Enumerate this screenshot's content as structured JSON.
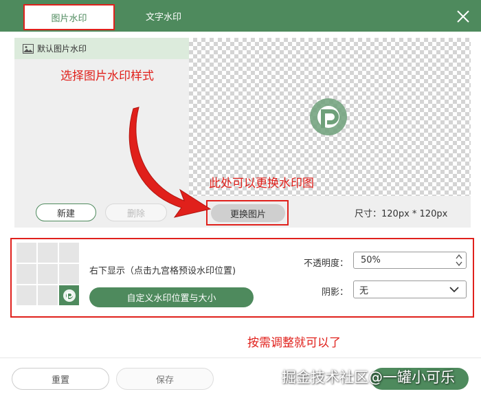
{
  "tabs": {
    "image_watermark": "图片水印",
    "text_watermark": "文字水印"
  },
  "watermark_list": {
    "default_item": "默认图片水印"
  },
  "actions": {
    "new": "新建",
    "delete": "删除",
    "change_image": "更换图片"
  },
  "preview": {
    "size_label": "尺寸：120px * 120px"
  },
  "annotations": {
    "select_style": "选择图片水印样式",
    "change_here": "此处可以更换水印图",
    "adjust": "按需调整就可以了"
  },
  "position": {
    "label": "右下显示（点击九宫格预设水印位置)",
    "selected_cell": "bottom-right",
    "custom_button": "自定义水印位置与大小"
  },
  "opacity": {
    "label": "不透明度：",
    "value": "50%"
  },
  "shadow": {
    "label": "阴影：",
    "value": "无"
  },
  "footer": {
    "reset": "重置",
    "save": "保存",
    "confirm": ""
  },
  "overlay_watermark": "掘金技术社区@一罐小可乐",
  "colors": {
    "brand_green": "#4e8a5d",
    "highlight_red": "#e0201b"
  }
}
